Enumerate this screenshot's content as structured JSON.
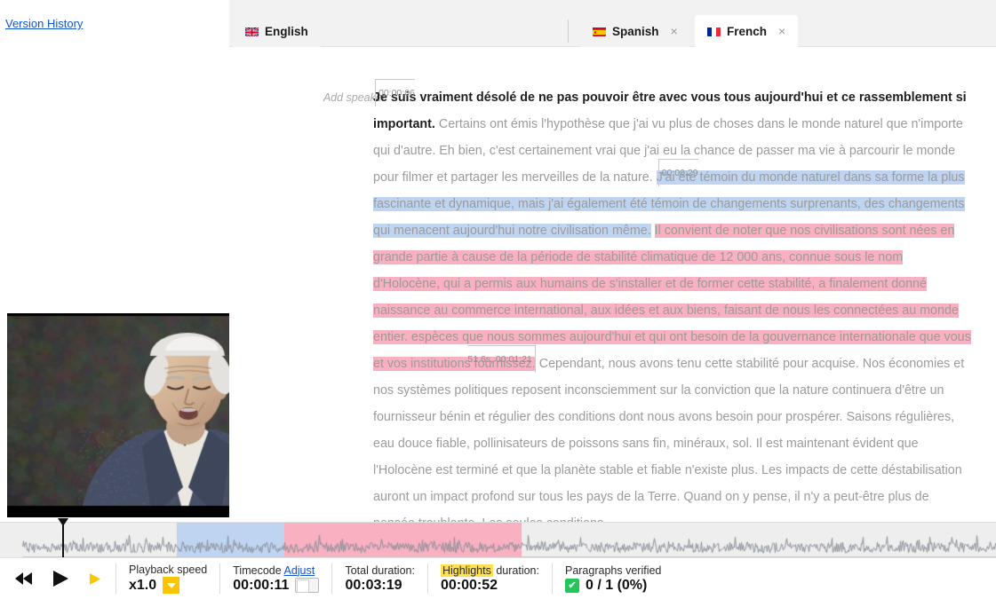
{
  "sidebar": {
    "version_history": "Version History"
  },
  "tabs": [
    {
      "label": "English",
      "flag": "uk-flag-icon",
      "closable": false,
      "active": false
    },
    {
      "label": "Spanish",
      "flag": "spain-flag-icon",
      "closable": true,
      "active": false
    },
    {
      "label": "French",
      "flag": "france-flag-icon",
      "closable": true,
      "active": true
    }
  ],
  "tab_close_glyph": "×",
  "transcript": {
    "add_speaker": "Add speaker",
    "timecode_start": "00:00:06",
    "timecode_blue_start": "00:00:29",
    "timecode_pink_end": "51.6s, 00:01:21",
    "lead_text": "Je suis vraiment désolé de ne pas pouvoir être avec vous tous aujourd'hui et ce rassemblement si important.",
    "body_before_blue": " Certains ont émis l'hypothèse que j'ai vu plus de choses dans le monde naturel que n'importe qui d'autre. Eh bien, c'est certainement vrai que j'ai eu la chance de passer ma vie à parcourir le monde pour filmer et partager les merveilles de la nature. ",
    "highlight_blue": "J'ai été témoin du monde naturel dans sa forme la plus fascinante et dynamique, mais j'ai également été témoin de changements surprenants, des changements qui menacent aujourd'hui notre civilisation même.",
    "between_blue_pink": " ",
    "highlight_pink": "Il convient de noter que nos civilisations sont nées en grande partie à cause de la période de stabilité climatique de 12 000 ans, connue sous le nom d'Holocène, qui a permis aux humains de s'installer et de former cette stabilité, a finalement donné naissance au commerce international, aux idées et aux biens, faisant de nous les connectées au monde entier. espèces que nous sommes aujourd'hui et qui ont besoin de la gouvernance internationale que vous et vos institutions fournissez.",
    "body_after_pink": " Cependant, nous avons tenu cette stabilité pour acquise. Nos économies et nos systèmes politiques reposent inconsciemment sur la conviction que la nature continuera d'être un fournisseur bénin et régulier des conditions dont nous avons besoin pour prospérer. Saisons régulières, eau douce fiable, pollinisateurs de poissons sans fin, minéraux, sol. Il est maintenant évident que l'Holocène est terminé et que la planète stable et fiable n'existe plus. Les impacts de cette déstabilisation auront un impact profond sur tous les pays de la Terre. Quand on y pense, il n'y a peut-être plus de pensée troublante. Les seules conditions"
  },
  "playback": {
    "rewind_icon": "rewind-icon",
    "play_icon": "play-icon",
    "forward_icon": "forward-icon"
  },
  "status": {
    "playback_speed_label": "Playback speed",
    "playback_speed_value": "x1.0",
    "timecode_label": "Timecode",
    "timecode_adjust_link": "Adjust",
    "timecode_value": "00:00:11",
    "total_duration_label": "Total duration:",
    "total_duration_value": "00:03:19",
    "highlights_label_chip": "Highlights",
    "highlights_label_rest": " duration:",
    "highlights_value": "00:00:52",
    "paragraphs_label": "Paragraphs verified",
    "paragraphs_value": "0 / 1 (0%)",
    "check_glyph": "✔"
  },
  "colors": {
    "highlight_blue": "#bed4f0",
    "highlight_pink": "#f9b0c0",
    "accent_yellow": "#ffc400",
    "link_blue": "#1155cc",
    "verified_green": "#23c65a",
    "chip_yellow": "#ffe14d"
  }
}
